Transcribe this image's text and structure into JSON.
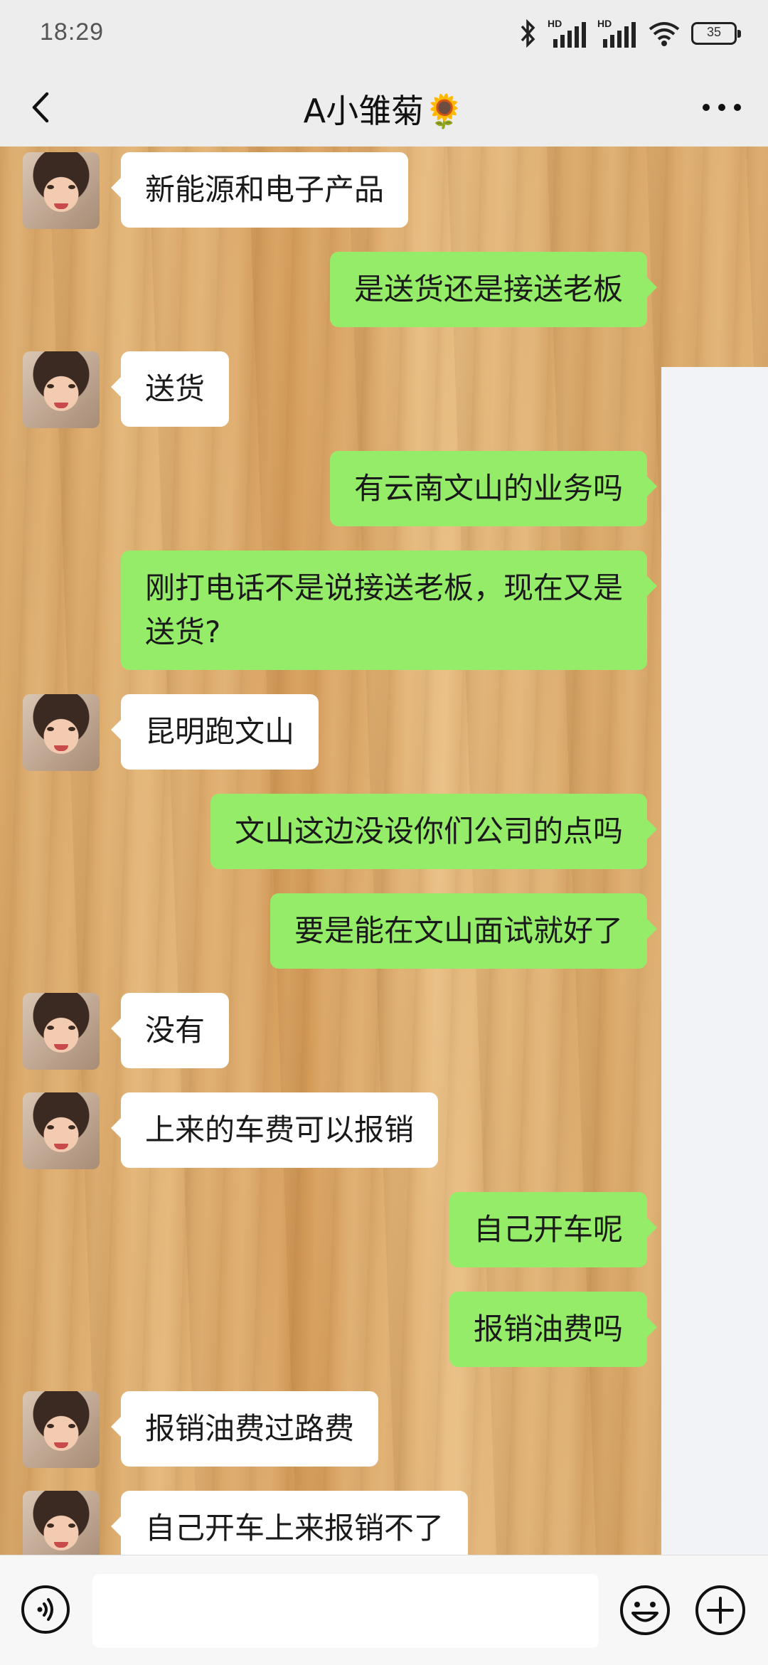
{
  "status_bar": {
    "time": "18:29",
    "battery": "35",
    "signal_label": "HD"
  },
  "header": {
    "title": "A小雏菊🌻"
  },
  "messages": [
    {
      "side": "left",
      "text": "新能源和电子产品"
    },
    {
      "side": "right",
      "text": "是送货还是接送老板"
    },
    {
      "side": "left",
      "text": "送货"
    },
    {
      "side": "right",
      "text": "有云南文山的业务吗"
    },
    {
      "side": "right",
      "text": "刚打电话不是说接送老板，现在又是送货?"
    },
    {
      "side": "left",
      "text": "昆明跑文山"
    },
    {
      "side": "right",
      "text": "文山这边没设你们公司的点吗"
    },
    {
      "side": "right",
      "text": "要是能在文山面试就好了"
    },
    {
      "side": "left",
      "text": "没有"
    },
    {
      "side": "left",
      "text": "上来的车费可以报销"
    },
    {
      "side": "right",
      "text": "自己开车呢"
    },
    {
      "side": "right",
      "text": "报销油费吗"
    },
    {
      "side": "left",
      "text": "报销油费过路费"
    },
    {
      "side": "left",
      "text": "自己开车上来报销不了"
    }
  ],
  "input": {
    "value": "",
    "placeholder": ""
  },
  "colors": {
    "sent_bubble": "#95ec69",
    "received_bubble": "#ffffff",
    "bar_bg": "#ededed"
  },
  "icons": [
    "back-arrow-icon",
    "more-dots-icon",
    "voice-icon",
    "emoji-icon",
    "plus-icon",
    "bluetooth-icon",
    "wifi-icon",
    "battery-icon"
  ]
}
